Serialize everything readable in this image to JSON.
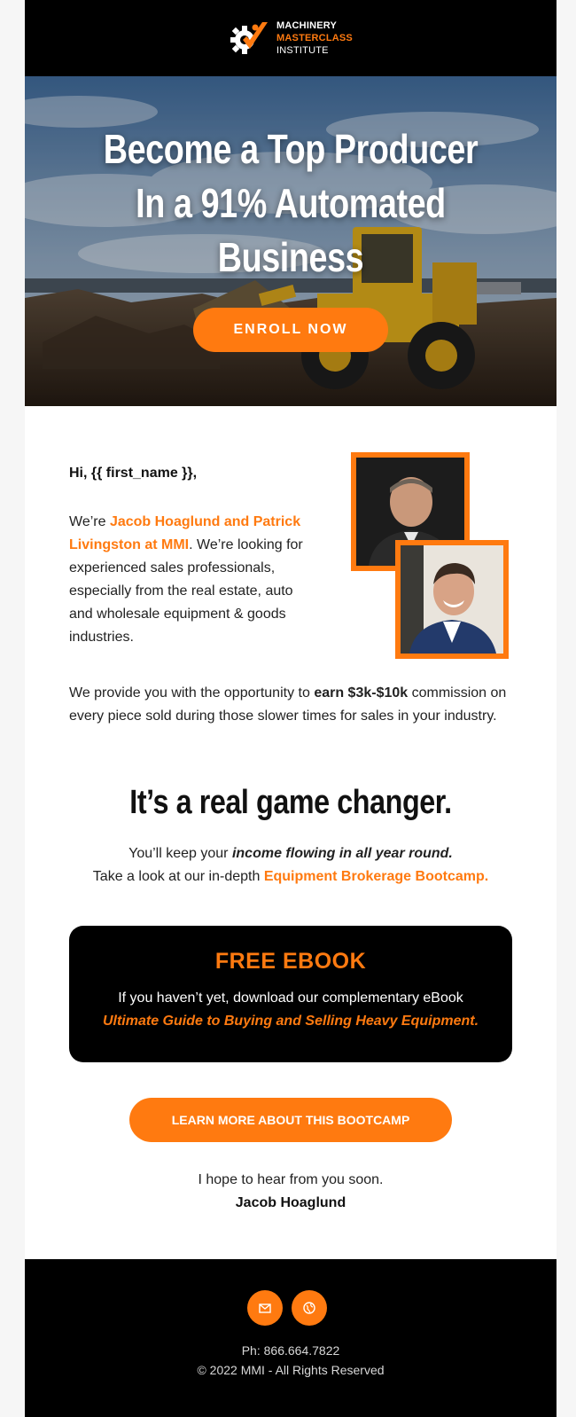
{
  "header": {
    "logo_line1": "MACHINERY",
    "logo_line2": "MASTERCLASS",
    "logo_line3": "INSTITUTE",
    "logo_icon": "gear-checkmark-icon"
  },
  "hero": {
    "title_line1": "Become a Top Producer",
    "title_line2": "In a 91% Automated",
    "title_line3": "Business",
    "cta": "ENROLL NOW",
    "image": "wheel-loader-construction-site"
  },
  "intro": {
    "greeting": "Hi, {{ first_name }},",
    "we_re": "We’re ",
    "names": "Jacob Hoaglund and Patrick Livingston at MMI",
    "rest": ". We’re looking for experienced sales professionals, especially from the real estate, auto and wholesale equipment & goods industries."
  },
  "provide": {
    "before": "We provide you with the opportunity to ",
    "bold": "earn $3k-$10k",
    "after": " commission on every piece sold during those slower times for sales in your industry."
  },
  "changer": {
    "title": "It’s a real game changer.",
    "line1_before": "You’ll keep your ",
    "line1_em": "income flowing in all year round.",
    "line2_before": "Take a look at our in-depth ",
    "line2_link": "Equipment Brokerage Bootcamp."
  },
  "ebook": {
    "title": "FREE EBOOK",
    "text": "If you haven’t yet, download our complementary eBook",
    "link": "Ultimate Guide to Buying and Selling Heavy Equipment."
  },
  "cta2": "LEARN MORE ABOUT THIS BOOTCAMP",
  "closing": {
    "hope": "I hope to hear from you soon.",
    "signature": "Jacob Hoaglund"
  },
  "footer": {
    "icons": [
      "mail-icon",
      "globe-icon"
    ],
    "phone": "Ph: 866.664.7822",
    "copyright": "© 2022 MMI - All Rights Reserved"
  },
  "colors": {
    "accent": "#ff7a10",
    "dark": "#000000",
    "background": "#f6f6f6"
  }
}
